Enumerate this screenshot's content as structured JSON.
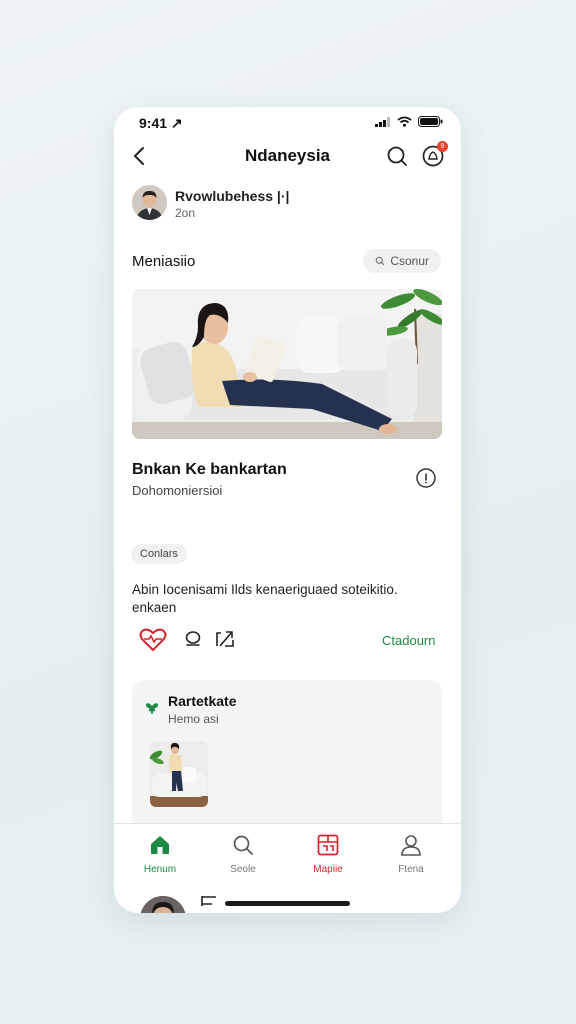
{
  "status_bar": {
    "time": "9:41 ↗"
  },
  "header": {
    "title": "Ndaneysia"
  },
  "notifications": {
    "badge_count": "9"
  },
  "author": {
    "name": "Rvowlubehess |·|",
    "time": "2on"
  },
  "section": {
    "title": "Meniasiio",
    "button_label": "Csonur"
  },
  "card": {
    "title": "Bnkan Ke bankartan",
    "subtitle": "Dohomoniersioi",
    "tag": "Conlars",
    "description": "Abin Iocenisami Ilds kenaeriguaed soteikitio. enkaen"
  },
  "actions": {
    "link_label": "Ctadourn"
  },
  "related": {
    "title": "Rartetkate",
    "subtitle": "Hemo asi"
  },
  "tabs": [
    {
      "label": "Henum",
      "icon": "home-icon",
      "color": "#1f8a44"
    },
    {
      "label": "Seole",
      "icon": "search-icon",
      "color": "#777777"
    },
    {
      "label": "Mapiie",
      "icon": "market-icon",
      "color": "#d8232a"
    },
    {
      "label": "Ftena",
      "icon": "profile-icon",
      "color": "#777777"
    }
  ],
  "colors": {
    "accent_green": "#1f8a44",
    "accent_red": "#d8232a",
    "badge": "#e8412c"
  }
}
